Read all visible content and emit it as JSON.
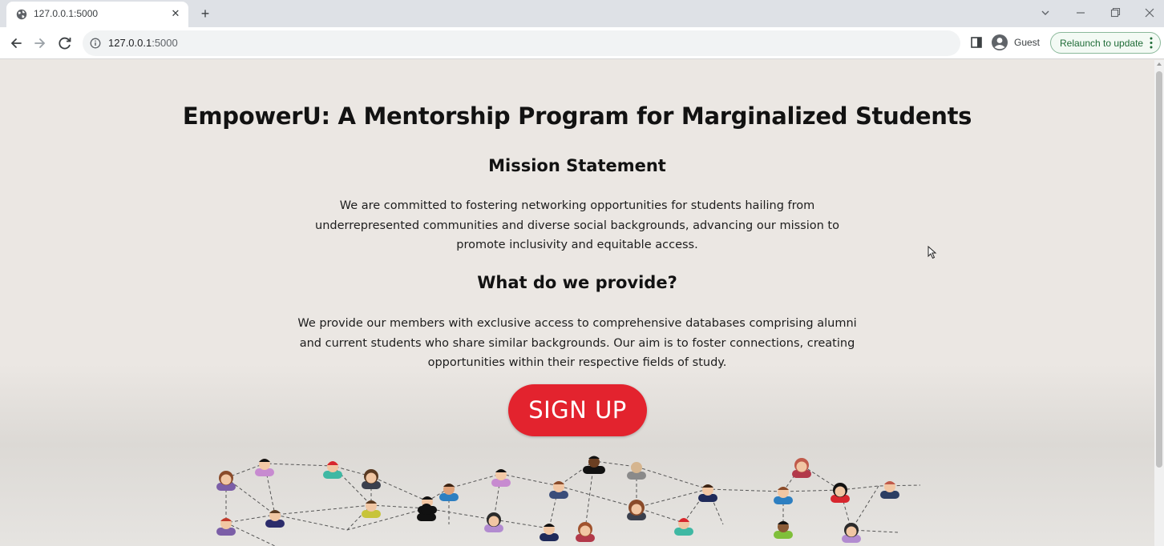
{
  "browser": {
    "tab_title": "127.0.0.1:5000",
    "new_tab_symbol": "+",
    "close_symbol": "✕",
    "url_host": "127.0.0.1",
    "url_port": ":5000",
    "profile_label": "Guest",
    "relaunch_label": "Relaunch to update"
  },
  "page": {
    "title": "EmpowerU: A Mentorship Program for Marginalized Students",
    "mission_title": "Mission Statement",
    "mission_text": "We are committed to fostering networking opportunities for students hailing from underrepresented communities and diverse social backgrounds, advancing our mission to promote inclusivity and equitable access.",
    "provide_title": "What do we provide?",
    "provide_text": "We provide our members with exclusive access to comprehensive databases comprising alumni and current students who share similar backgrounds. Our aim is to foster connections, creating opportunities within their respective fields of study.",
    "signup_label": "SIGN UP",
    "signup_color": "#e3232e"
  },
  "icons": {
    "tab_favicon": "globe-icon",
    "back": "back-arrow-icon",
    "forward": "forward-arrow-icon",
    "reload": "reload-icon",
    "site_info": "info-icon",
    "side_panel": "side-panel-icon",
    "profile": "profile-avatar-icon",
    "menu": "vertical-dots-icon",
    "network": "people-network-illustration"
  }
}
